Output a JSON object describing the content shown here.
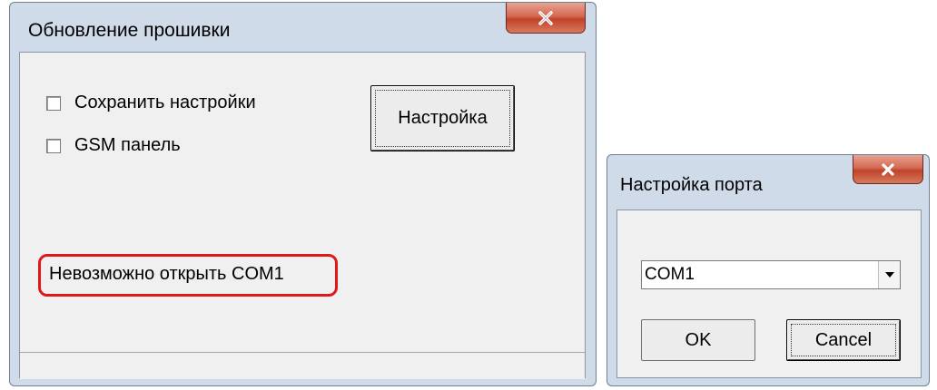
{
  "firmware_window": {
    "title": "Обновление прошивки",
    "close_icon": "close-icon",
    "save_settings_label": "Сохранить настройки",
    "gsm_panel_label": "GSM панель",
    "settings_button_label": "Настройка",
    "status_message": "Невозможно открыть COM1",
    "highlight_color": "#e01818"
  },
  "port_window": {
    "title": "Настройка порта",
    "close_icon": "close-icon",
    "port_select_value": "COM1",
    "dropdown_icon": "chevron-down-icon",
    "ok_label": "OK",
    "cancel_label": "Cancel"
  }
}
